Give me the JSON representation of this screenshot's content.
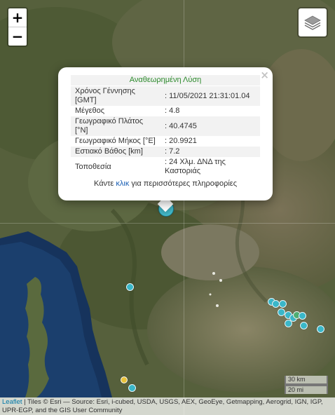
{
  "controls": {
    "zoom_in": "+",
    "zoom_out": "−",
    "layers_icon": "layers-icon"
  },
  "popup": {
    "close": "×",
    "header": "Αναθεωρημένη Λύση",
    "rows": [
      {
        "key": "Χρόνος Γέννησης [GMT]",
        "value": ": 11/05/2021 21:31:01.04"
      },
      {
        "key": "Μέγεθος",
        "value": ": 4.8"
      },
      {
        "key": "Γεωγραφικό Πλάτος [°N]",
        "value": ": 40.4745"
      },
      {
        "key": "Γεωγραφικό Μήκος [°E]",
        "value": ": 20.9921"
      },
      {
        "key": "Εστιακό Βάθος [km]",
        "value": ": 7.2"
      },
      {
        "key": "Τοποθεσία",
        "value": ": 24 Χλμ. ΔΝΔ της Καστοριάς"
      }
    ],
    "more_prefix": "Κάντε",
    "more_link": "κλικ",
    "more_suffix": "για περισσότερες πληροφορίες"
  },
  "scale": {
    "km": "30 km",
    "mi": "20 mi"
  },
  "attribution": {
    "leaflet": "Leaflet",
    "text": " | Tiles © Esri — Source: Esri, i-cubed, USDA, USGS, AEX, GeoEye, Getmapping, Aerogrid, IGN, IGP, UPR-EGP, and the GIS User Community"
  },
  "colors": {
    "marker": "#3ab7c9",
    "marker_highlight": "#e8c23a",
    "header_text": "#2c8a2c"
  }
}
